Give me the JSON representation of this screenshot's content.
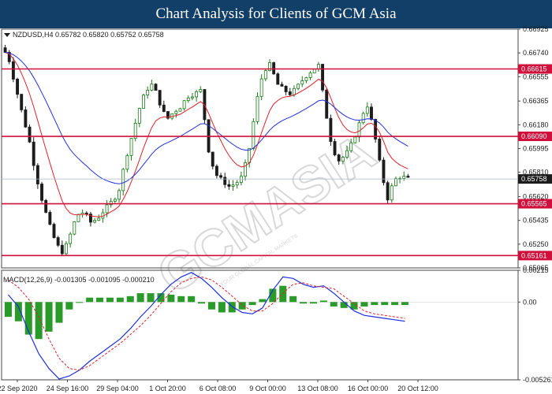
{
  "header": {
    "title": "Chart Analysis for Clients of GCM Asia"
  },
  "watermark": {
    "text": "GCMASIA",
    "tagline": "YOUR GLOBAL CAPITAL MARKETS"
  },
  "chart_data": [
    {
      "type": "line",
      "symbol_info": "NZDUSD,H4  0.65782 0.65820 0.65752 0.65758",
      "y_ticks": [
        0.66925,
        0.6674,
        0.66555,
        0.66365,
        0.6618,
        0.65995,
        0.6581,
        0.6562,
        0.65435,
        0.6525,
        0.65065
      ],
      "ylim": [
        0.65065,
        0.66925
      ],
      "current_price": {
        "value": 0.65758,
        "label": "0.65758",
        "color": "#1c1c1c"
      },
      "levels": [
        {
          "value": 0.66615,
          "label": "0.66615",
          "color": "#d0103a"
        },
        {
          "value": 0.6609,
          "label": "0.66090",
          "color": "#d0103a"
        },
        {
          "value": 0.65565,
          "label": "0.65565",
          "color": "#d0103a"
        },
        {
          "value": 0.65161,
          "label": "0.65161",
          "color": "#d0103a"
        }
      ],
      "price_path": [
        0.6678,
        0.6672,
        0.665,
        0.6628,
        0.6608,
        0.658,
        0.6558,
        0.654,
        0.6525,
        0.6518,
        0.6532,
        0.6548,
        0.655,
        0.6542,
        0.6545,
        0.6552,
        0.6558,
        0.6565,
        0.659,
        0.661,
        0.663,
        0.6645,
        0.665,
        0.6635,
        0.6622,
        0.6628,
        0.6632,
        0.664,
        0.6642,
        0.6645,
        0.66,
        0.658,
        0.6575,
        0.657,
        0.6572,
        0.6578,
        0.66,
        0.6635,
        0.666,
        0.6665,
        0.665,
        0.6645,
        0.6642,
        0.6648,
        0.6655,
        0.666,
        0.6665,
        0.663,
        0.66,
        0.659,
        0.6595,
        0.6605,
        0.662,
        0.6635,
        0.6615,
        0.6585,
        0.656,
        0.6575,
        0.6578,
        0.65758
      ],
      "series_colors": {
        "fast_ma": "#e0202a",
        "slow_ma": "#2030e0",
        "bull": "#1a7a1a",
        "bear": "#1c1c1c"
      }
    },
    {
      "type": "bar",
      "title": "MACD(12,26,9) -0.001305 -0.001095 -0.000210",
      "y_ticks": [
        0.00215,
        0.0,
        -0.00526
      ],
      "y_tick_labels": [
        "0.00215",
        "0.00",
        "-0.005261"
      ],
      "ylim": [
        -0.00526,
        0.00215
      ],
      "macd_values": [
        0.0005,
        -0.0003,
        -0.002,
        -0.0035,
        -0.0045,
        -0.0052,
        -0.005,
        -0.0046,
        -0.004,
        -0.0035,
        -0.003,
        -0.0025,
        -0.0018,
        -0.001,
        -0.0003,
        0.0005,
        0.0012,
        0.0017,
        0.002,
        0.0016,
        0.001,
        0.0003,
        -0.0003,
        -0.0007,
        -0.0008,
        -0.0004,
        0.0008,
        0.0017,
        0.0016,
        0.0012,
        0.001,
        0.0011,
        0.0006,
        0.0,
        -0.0006,
        -0.0009,
        -0.001,
        -0.0011,
        -0.0012,
        -0.0013
      ],
      "signal_values": [
        0.0015,
        0.001,
        0.0002,
        -0.001,
        -0.0025,
        -0.0038,
        -0.0045,
        -0.0046,
        -0.0043,
        -0.0038,
        -0.0033,
        -0.0028,
        -0.0022,
        -0.0016,
        -0.0009,
        -0.0001,
        0.0007,
        0.0013,
        0.0016,
        0.0017,
        0.0015,
        0.001,
        0.0004,
        -0.0002,
        -0.0006,
        -0.0006,
        -0.0001,
        0.0006,
        0.0012,
        0.0013,
        0.0011,
        0.001,
        0.0009,
        0.0004,
        -0.0001,
        -0.0006,
        -0.0008,
        -0.0009,
        -0.001,
        -0.0011
      ],
      "series_colors": {
        "macd": "#1d2fe0",
        "signal": "#e0202a",
        "histogram": "#2a9a2a"
      }
    }
  ],
  "x_labels": [
    "22 Sep 2020",
    "24 Sep 16:00",
    "29 Sep 04:00",
    "1 Oct 20:00",
    "6 Oct 08:00",
    "9 Oct 00:00",
    "13 Oct 08:00",
    "16 Oct 00:00",
    "20 Oct 12:00"
  ]
}
